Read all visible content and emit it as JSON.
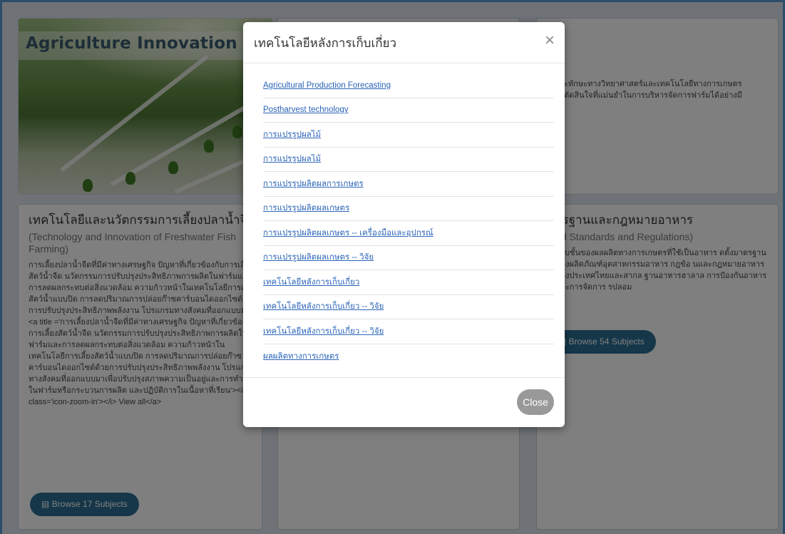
{
  "hero": {
    "title": "Agriculture Innovation"
  },
  "card_top_right": {
    "text_line1": "ะทักษะทางวิทยาศาสตร์และเทคโนโลยีทางการเกษตร",
    "text_line2": "ตัดสินใจที่แม่นยำในการบริหารจัดการฟาร์มได้อย่างมี"
  },
  "card_left": {
    "title": "เทคโนโลยีและนวัตกรรมการเลี้ยงปลาน้ำจืด",
    "subtitle": "(Technology and Innovation of Freshwater Fish Farming)",
    "description": "การเลี้ยงปลาน้ำจืดที่มีค่าทางเศรษฐกิจ ปัญหาที่เกี่ยวข้องกับการเลี้ยงสัตว์น้ำจืด นวัตกรรมการปรับปรุงประสิทธิภาพการผลิตในฟาร์มและการลดผลกระทบต่อสิ่งแวดล้อม ความก้าวหน้าในเทคโนโลยีการเลี้ยงสัตว์น้ำแบบปิด การลดปริมาณการปล่อยก๊าซคาร์บอนไดออกไซด์ด้วยการปรับปรุงประสิทธิภาพพลังงาน โปรแกรมทางสังคมที่ออกแบบมา...<a title ='การเลี้ยงปลาน้ำจืดที่มีค่าทางเศรษฐกิจ ปัญหาที่เกี่ยวข้องกับการเลี้ยงสัตว์น้ำจืด นวัตกรรมการปรับปรุงประสิทธิภาพการผลิตในฟาร์มและการลดผลกระทบต่อสิ่งแวดล้อม ความก้าวหน้าในเทคโนโลยีการเลี้ยงสัตว์น้ำแบบปิด การลดปริมาณการปล่อยก๊าซคาร์บอนไดออกไซด์ด้วยการปรับปรุงประสิทธิภาพพลังงาน โปรแกรมทางสังคมที่ออกแบบมาเพื่อปรับปรุงสภาพความเป็นอยู่และการทำงานในฟาร์มหรือกระบวนการผลิต และปฏิบัติการในเนื้อหาที่เรียน'><i class='icon-zoom-in'></i> View all</a>",
    "browse_label": "Browse 17 Subjects"
  },
  "card_right": {
    "title": "ารฐานและกฎหมายอาหาร",
    "subtitle": "od Standards and Regulations)",
    "description": "ะดับชั้นของผลผลิตทางการเกษตรที่ใช้เป็นอาหาร ดตั้งมาตรฐานของผลิตภัณฑ์อุตสาหกรรมอาหาร กฎข้อ นและกฎหมายอาหารของประเทศไทยและสากล ฐานอาหารฮาลาล การป้องกันอาหาร และการจัดการ รปลอม",
    "browse_label": "Browse 54 Subjects"
  },
  "modal": {
    "title": "เทคโนโลยีหลังการเก็บเกี่ยว",
    "close_icon": "×",
    "links": [
      "Agricultural Production Forecasting",
      "Postharvest technology",
      "การแปรรูปผลไม้",
      "การแปรรูปผลไม้",
      "การแปรรูปผลิตผลการเกษตร",
      "การแปรรูปผลิตผลเกษตร",
      "การแปรรูปผลิตผลเกษตร -- เครื่องมือและอุปกรณ์",
      "การแปรรูปผลิตผลเกษตร -- วิจัย",
      "เทคโนโลยีหลังการเก็บเกี่ยว",
      "เทคโนโลยีหลังการเก็บเกี่ยว -- วิจัย",
      "เทคโนโลยีหลังการเก็บเกี่ยว -- วิจัย",
      "ผลผลิตทางการเกษตร"
    ],
    "close_button": "Close"
  }
}
